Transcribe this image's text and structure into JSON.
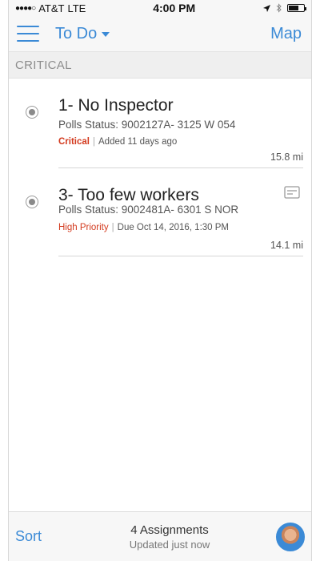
{
  "status_bar": {
    "signal": "●●●●○",
    "carrier": "AT&T",
    "network": "LTE",
    "time": "4:00 PM",
    "location_icon": "location-arrow-icon",
    "bluetooth_icon": "bluetooth-icon",
    "battery_level": 0.65
  },
  "nav": {
    "menu_icon": "hamburger-menu-icon",
    "title": "To Do",
    "map_label": "Map"
  },
  "section": {
    "title": "CRITICAL"
  },
  "items": [
    {
      "title": "1- No Inspector",
      "subtitle": "Polls Status: 9002127A- 3125 W 054",
      "priority": "Critical",
      "meta": "Added 11 days ago",
      "distance": "15.8 mi",
      "has_note": false
    },
    {
      "title": "3- Too few workers",
      "subtitle": "Polls Status: 9002481A- 6301 S NOR",
      "priority": "High Priority",
      "meta": "Due Oct 14, 2016, 1:30 PM",
      "distance": "14.1 mi",
      "has_note": true
    }
  ],
  "footer": {
    "sort_label": "Sort",
    "assignments": "4 Assignments",
    "updated": "Updated just now",
    "avatar_icon": "user-avatar-icon"
  },
  "colors": {
    "accent": "#3b8ad6",
    "critical": "#d33a1e"
  }
}
